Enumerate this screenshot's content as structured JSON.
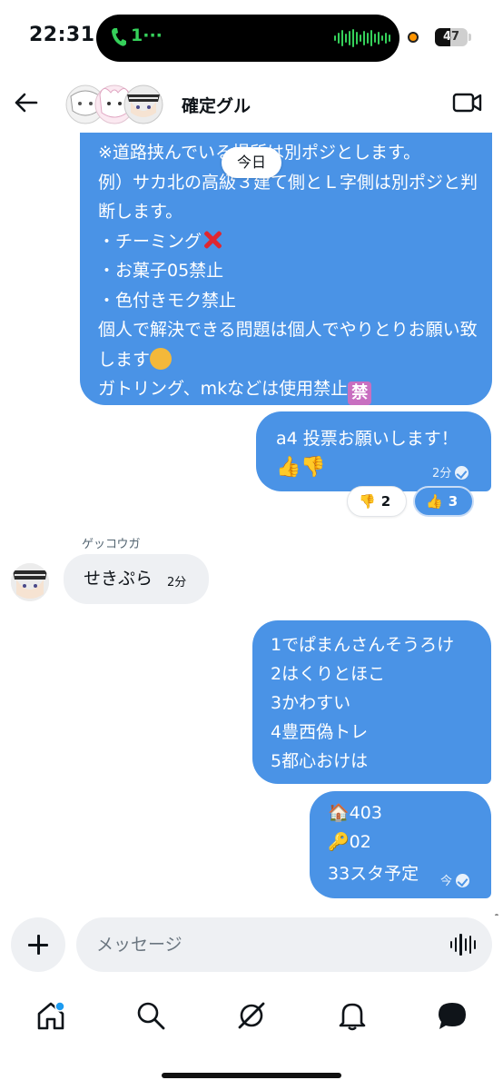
{
  "status_bar": {
    "time": "22:31",
    "call_text": "1···",
    "battery": "47"
  },
  "header": {
    "title": "確定グル",
    "back_icon": "arrow-left-icon",
    "video_icon": "video-camera-icon"
  },
  "chat": {
    "date_chip": "今日",
    "rules_lines": [
      "※道路挟んでいる場所は別ポジとします。",
      "例）サカ北の高級３建て側とＬ字側は別ポジと判断します。",
      "・チーミング",
      "・お菓子05禁止",
      "・色付きモク禁止",
      "個人で解決できる問題は個人でやりとりお願い致します",
      "ガトリング、mkなどは使用禁止"
    ],
    "rules_emoji_kin": "禁",
    "vote_message": {
      "text": "a4 投票お願いします！",
      "thumbs": "👍👎",
      "time": "2分"
    },
    "reactions": [
      {
        "emoji": "👎",
        "count": "2"
      },
      {
        "emoji": "👍",
        "count": "3"
      }
    ],
    "incoming": {
      "sender": "ゲッコウガ",
      "text": "せきぷら",
      "time": "2分"
    },
    "list_message": {
      "lines": [
        "1でぱまんさんそうろけ",
        "2はくりとほこ",
        "3かわすい",
        "4豊西偽トレ",
        "5都心おけは"
      ]
    },
    "info_message": {
      "lines": [
        "🏠403",
        "🔑02",
        "33スタ予定"
      ],
      "time": "今"
    }
  },
  "composer": {
    "placeholder": "メッセージ"
  },
  "nav": {
    "items": [
      "home-icon",
      "search-icon",
      "grok-icon",
      "bell-icon",
      "messages-icon"
    ]
  },
  "colors": {
    "bubble_blue": "#4a93e6",
    "bubble_gray": "#eef0f3",
    "call_green": "#35d05a",
    "notification_dot": "#1d9bf0"
  }
}
